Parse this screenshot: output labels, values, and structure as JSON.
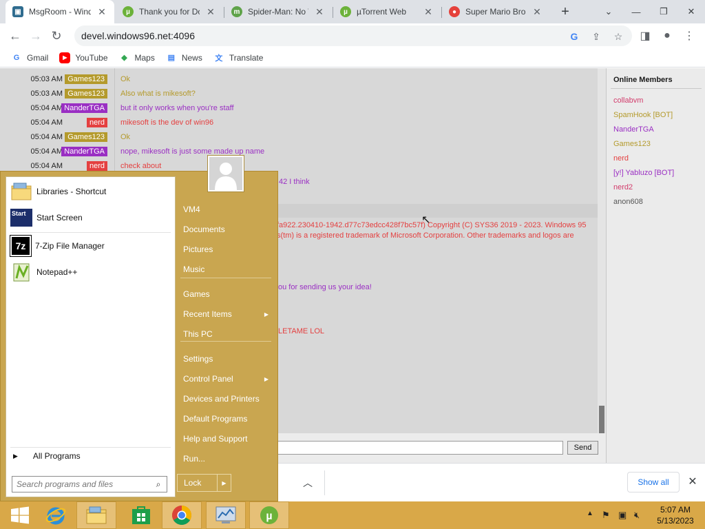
{
  "browser": {
    "tabs": [
      {
        "title": "MsgRoom - Wind",
        "icon": "windows96-icon",
        "color": "#2f6c8f"
      },
      {
        "title": "Thank you for Do",
        "icon": "utorrent-icon",
        "color": "#6cb23a"
      },
      {
        "title": "Spider-Man: No W",
        "icon": "utorrent-m-icon",
        "color": "#5fa34a"
      },
      {
        "title": "µTorrent Web",
        "icon": "utorrent-icon",
        "color": "#6cb23a"
      },
      {
        "title": "Super Mario Bros",
        "icon": "mario-icon",
        "color": "#e5413b"
      }
    ],
    "new_tab": "+",
    "url": "devel.windows96.net:4096",
    "bookmarks": [
      {
        "label": "Gmail",
        "icon": "google-icon"
      },
      {
        "label": "YouTube",
        "icon": "youtube-icon"
      },
      {
        "label": "Maps",
        "icon": "maps-icon"
      },
      {
        "label": "News",
        "icon": "news-icon"
      },
      {
        "label": "Translate",
        "icon": "translate-icon"
      }
    ]
  },
  "chat": {
    "messages": [
      {
        "time": "05:03 AM",
        "nick": "Games123",
        "nick_color": "#b49a2c",
        "text": "Ok",
        "text_color": "#b49a2c"
      },
      {
        "time": "05:03 AM",
        "nick": "Games123",
        "nick_color": "#b49a2c",
        "text": "Also what is mikesoft?",
        "text_color": "#b49a2c"
      },
      {
        "time": "05:04 AM",
        "nick": "NanderTGA",
        "nick_color": "#9a2fc3",
        "text": "but it only works when you're staff",
        "text_color": "#9a2fc3"
      },
      {
        "time": "05:04 AM",
        "nick": "nerd",
        "nick_color": "#e44040",
        "text": "mikesoft is the dev of win96",
        "text_color": "#e44040"
      },
      {
        "time": "05:04 AM",
        "nick": "Games123",
        "nick_color": "#b49a2c",
        "text": "Ok",
        "text_color": "#b49a2c"
      },
      {
        "time": "05:04 AM",
        "nick": "NanderTGA",
        "nick_color": "#9a2fc3",
        "text": "nope, mikesoft is just some made up name",
        "text_color": "#9a2fc3"
      },
      {
        "time": "05:04 AM",
        "nick": "nerd",
        "nick_color": "#e44040",
        "text": "check about",
        "text_color": "#e44040"
      }
    ],
    "partial_lines": [
      {
        "text": "42 I think",
        "color": "#9a2fc3"
      },
      {
        "text": "fa922.230410-1942.d77c73edcc428f7bc57f) Copyright (C) SYS36 2019 - 2023.  Windows 95",
        "color": "#e44040"
      },
      {
        "text": "s(tm) is a registered trademark of Microsoft Corporation. Other trademarks and logos are",
        "color": "#e44040"
      },
      {
        "text": "ou for sending us your idea!",
        "color": "#9a2fc3"
      },
      {
        "text": "LETAME LOL",
        "color": "#e44040"
      }
    ],
    "send_label": "Send"
  },
  "members": {
    "title": "Online Members",
    "list": [
      {
        "name": "collabvm",
        "color": "#d23b6b"
      },
      {
        "name": "SpamHook [BOT]",
        "color": "#b49a2c"
      },
      {
        "name": "NanderTGA",
        "color": "#9a2fc3"
      },
      {
        "name": "Games123",
        "color": "#b49a2c"
      },
      {
        "name": "nerd",
        "color": "#e44040"
      },
      {
        "name": "[y!] Yabluzo [BOT]",
        "color": "#9a2fc3"
      },
      {
        "name": "nerd2",
        "color": "#d23b6b"
      },
      {
        "name": "anon608",
        "color": "#555555"
      }
    ]
  },
  "downloads": {
    "show_all": "Show all"
  },
  "start_menu": {
    "pinned": [
      {
        "label": "Libraries - Shortcut",
        "icon": "libraries-icon"
      },
      {
        "label": "Start Screen",
        "icon": "start-screen-icon",
        "icon_text": "Start"
      },
      {
        "label": "7-Zip File Manager",
        "icon": "7zip-icon",
        "icon_text": "7z"
      },
      {
        "label": "Notepad++",
        "icon": "notepadpp-icon"
      }
    ],
    "all_programs": "All Programs",
    "search_placeholder": "Search programs and files",
    "right_items": [
      {
        "label": "VM4"
      },
      {
        "label": "Documents"
      },
      {
        "label": "Pictures"
      },
      {
        "label": "Music"
      },
      {
        "label": "Games"
      },
      {
        "label": "Recent Items",
        "submenu": true
      },
      {
        "label": "This PC"
      },
      {
        "label": "Settings"
      },
      {
        "label": "Control Panel",
        "submenu": true
      },
      {
        "label": "Devices and Printers"
      },
      {
        "label": "Default Programs"
      },
      {
        "label": "Help and Support"
      },
      {
        "label": "Run..."
      }
    ],
    "lock_label": "Lock"
  },
  "taskbar": {
    "apps": [
      "ie-icon",
      "file-explorer-icon",
      "store-icon",
      "chrome-icon",
      "system-monitor-icon",
      "utorrent-icon"
    ],
    "clock_time": "5:07 AM",
    "clock_date": "5/13/2023"
  }
}
